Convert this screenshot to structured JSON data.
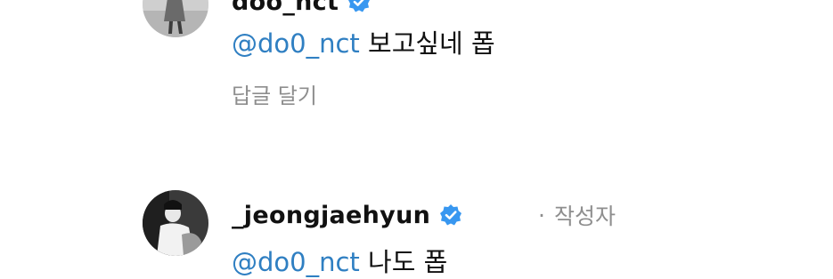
{
  "comments": [
    {
      "username": "doo_nct",
      "verified": true,
      "mention": "@do0_nct",
      "text": "보고싶네 폽",
      "reply_label": "답글 달기"
    },
    {
      "username": "_jeongjaehyun",
      "verified": true,
      "author_separator": "·",
      "author_badge": "작성자",
      "mention": "@do0_nct",
      "text": "나도 폽"
    }
  ],
  "colors": {
    "mention": "#2f7fc2",
    "verified_badge": "#3897f0",
    "muted_text": "#8e8e8e"
  },
  "icons": {
    "verified": "verified-badge-icon",
    "avatar": "profile-photo"
  }
}
